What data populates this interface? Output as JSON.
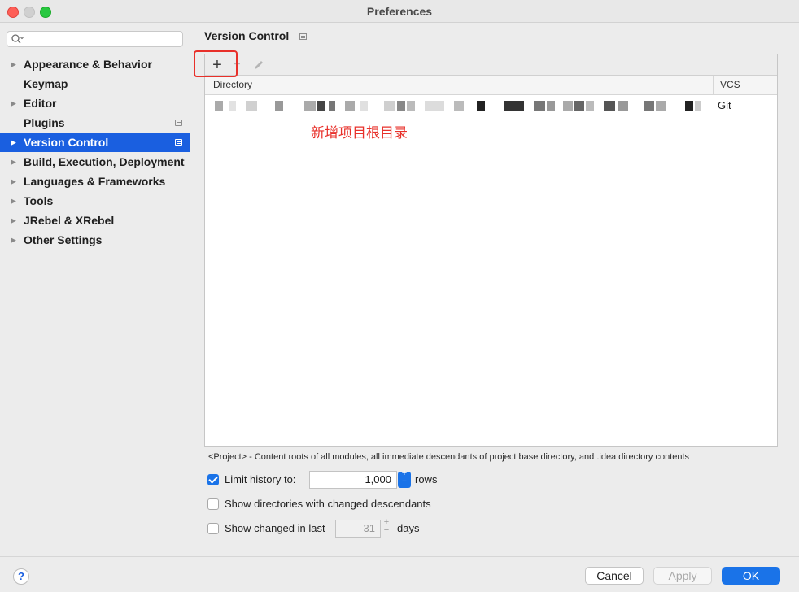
{
  "window": {
    "title": "Preferences"
  },
  "sidebar": {
    "search_placeholder": "",
    "items": [
      {
        "label": "Appearance & Behavior",
        "expandable": true,
        "badge": false,
        "selected": false
      },
      {
        "label": "Keymap",
        "expandable": false,
        "badge": false,
        "selected": false
      },
      {
        "label": "Editor",
        "expandable": true,
        "badge": false,
        "selected": false
      },
      {
        "label": "Plugins",
        "expandable": false,
        "badge": true,
        "selected": false
      },
      {
        "label": "Version Control",
        "expandable": true,
        "badge": true,
        "selected": true
      },
      {
        "label": "Build, Execution, Deployment",
        "expandable": true,
        "badge": false,
        "selected": false
      },
      {
        "label": "Languages & Frameworks",
        "expandable": true,
        "badge": false,
        "selected": false
      },
      {
        "label": "Tools",
        "expandable": true,
        "badge": false,
        "selected": false
      },
      {
        "label": "JRebel & XRebel",
        "expandable": true,
        "badge": false,
        "selected": false
      },
      {
        "label": "Other Settings",
        "expandable": true,
        "badge": false,
        "selected": false
      }
    ]
  },
  "main": {
    "title": "Version Control",
    "toolbar": {
      "add": "+",
      "remove": "−"
    },
    "table": {
      "columns": [
        "Directory",
        "VCS"
      ],
      "rows": [
        {
          "directory": "",
          "vcs": "Git"
        }
      ]
    },
    "annotation": "新增项目根目录",
    "footnote": "<Project> - Content roots of all modules, all immediate descendants of project base directory, and .idea directory contents",
    "options": {
      "limit_history": {
        "label": "Limit history to:",
        "checked": true,
        "value": "1,000",
        "unit": "rows"
      },
      "show_dirs": {
        "label": "Show directories with changed descendants",
        "checked": false
      },
      "show_changed": {
        "label": "Show changed in last",
        "checked": false,
        "value": "31",
        "unit": "days"
      }
    }
  },
  "footer": {
    "help": "?",
    "cancel": "Cancel",
    "apply": "Apply",
    "ok": "OK"
  },
  "colors": {
    "accent": "#1a73e8",
    "selection": "#1a5fe0",
    "annotation": "#e8302a"
  }
}
